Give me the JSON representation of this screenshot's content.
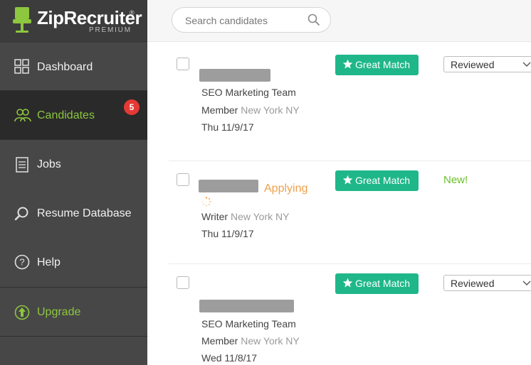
{
  "brand": {
    "name": "ZipRecruiter",
    "registered": "®",
    "tier": "PREMIUM"
  },
  "sidebar": {
    "items": [
      {
        "label": "Dashboard",
        "icon": "dashboard-icon"
      },
      {
        "label": "Candidates",
        "icon": "candidates-icon",
        "badge": "5",
        "active": true
      },
      {
        "label": "Jobs",
        "icon": "jobs-icon"
      },
      {
        "label": "Resume Database",
        "icon": "search-icon"
      },
      {
        "label": "Help",
        "icon": "help-icon"
      },
      {
        "label": "Upgrade",
        "icon": "upgrade-icon"
      }
    ]
  },
  "search": {
    "placeholder": "Search candidates"
  },
  "candidates": [
    {
      "job": "SEO Marketing Team",
      "type": "Member",
      "location": "New York NY",
      "date": "Thu 11/9/17",
      "match": "Great Match",
      "status": "Reviewed"
    },
    {
      "applying": "Applying",
      "job": "Writer",
      "location": "New York NY",
      "date": "Thu 11/9/17",
      "match": "Great Match",
      "status": "New!"
    },
    {
      "job": "SEO Marketing Team",
      "type": "Member",
      "location": "New York NY",
      "date": "Wed 11/8/17",
      "match": "Great Match",
      "status": "Reviewed"
    }
  ],
  "colors": {
    "accent_green": "#8dc63f",
    "match_teal": "#1fb789",
    "badge_red": "#e53935",
    "applying_orange": "#f0a04b"
  }
}
